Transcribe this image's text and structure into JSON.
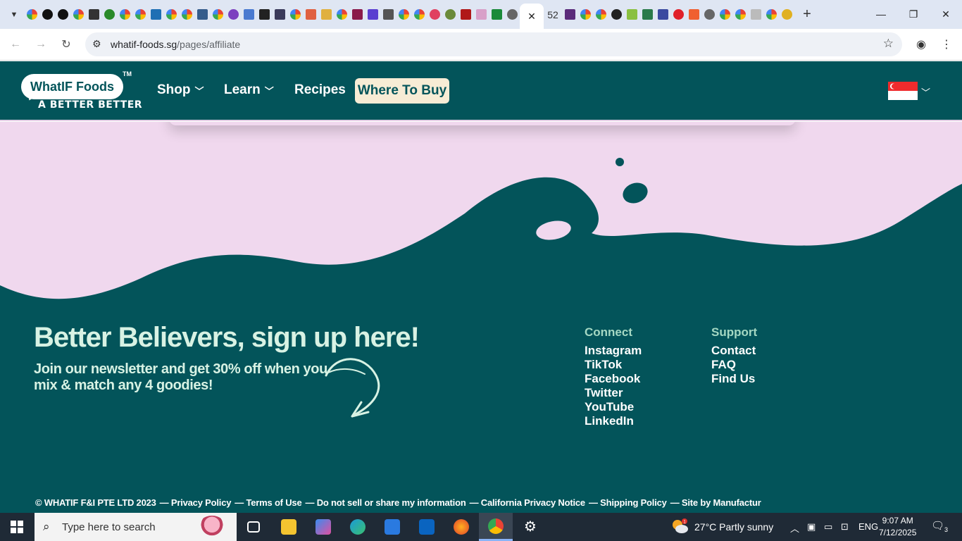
{
  "browser": {
    "active_tab_close": "✕",
    "tab_count_label": "52",
    "url_host": "whatif-foods.sg",
    "url_path": "/pages/affiliate",
    "window": {
      "minimize": "—",
      "restore": "❐",
      "close": "✕"
    }
  },
  "site": {
    "logo_text": "WhatIF Foods",
    "logo_tm": "TM",
    "logo_tagline": "A BETTER BETTER",
    "nav": [
      {
        "label": "Shop",
        "has_menu": true
      },
      {
        "label": "Learn",
        "has_menu": true
      },
      {
        "label": "Recipes",
        "has_menu": false
      }
    ],
    "cta_label": "Where To Buy",
    "region_flag": "Singapore flag"
  },
  "footer": {
    "newsletter_title": "Better Believers, sign up here!",
    "newsletter_text": "Join our newsletter and get 30% off when you mix & match any 4 goodies!",
    "connect_heading": "Connect",
    "connect_links": [
      "Instagram",
      "TikTok",
      "Facebook",
      "Twitter",
      "YouTube",
      "LinkedIn"
    ],
    "support_heading": "Support",
    "support_links": [
      "Contact",
      "FAQ",
      "Find Us"
    ],
    "legal": [
      "© WHATIF F&I PTE LTD 2023",
      "— Privacy Policy",
      "— Terms of Use",
      "— Do not sell or share my information",
      "— California Privacy Notice",
      "— Shipping Policy",
      "— Site by Manufactur"
    ]
  },
  "taskbar": {
    "search_placeholder": "Type here to search",
    "weather": "27°C  Partly sunny",
    "weather_badge": "1",
    "language": "ENG",
    "time": "9:07 AM",
    "date": "7/12/2025",
    "notifications": "3"
  },
  "colors": {
    "brand_teal": "#03545a",
    "pink_bg": "#f0d8ee",
    "cta_bg": "#f7ecd5",
    "mint_text": "#d8f2e4"
  }
}
